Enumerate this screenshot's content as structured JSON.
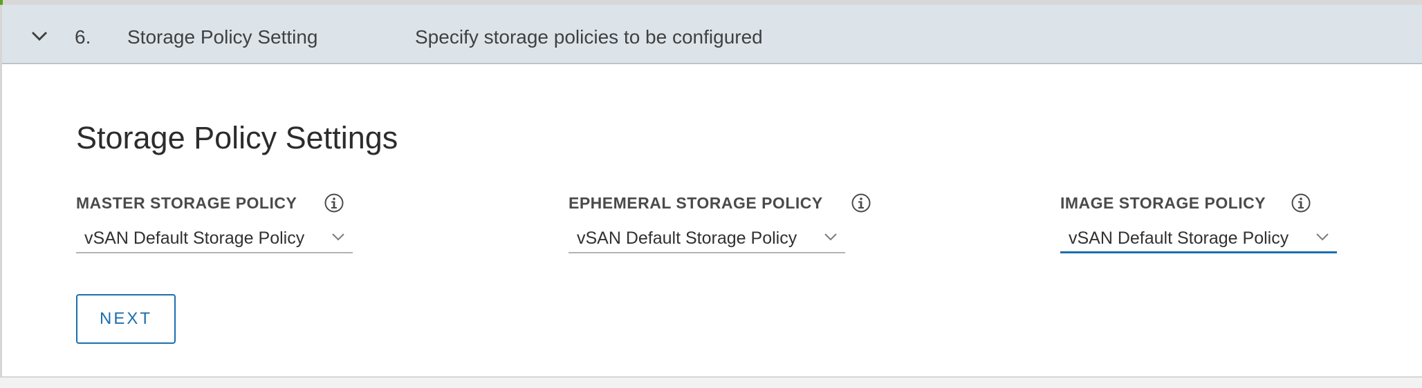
{
  "step": {
    "number": "6.",
    "title": "Storage Policy Setting",
    "description": "Specify storage policies to be configured",
    "expanded": true
  },
  "section": {
    "title": "Storage Policy Settings"
  },
  "fields": {
    "master": {
      "label": "MASTER STORAGE POLICY",
      "value": "vSAN Default Storage Policy"
    },
    "ephemeral": {
      "label": "EPHEMERAL STORAGE POLICY",
      "value": "vSAN Default Storage Policy"
    },
    "image": {
      "label": "IMAGE STORAGE POLICY",
      "value": "vSAN Default Storage Policy",
      "focused": true
    }
  },
  "actions": {
    "next_label": "NEXT"
  },
  "icons": {
    "step_toggle": "chevron-down-icon",
    "info": "info-icon",
    "select_caret": "caret-down-icon"
  },
  "colors": {
    "header_bg": "#dce4ea",
    "accent_blue": "#1b6eae",
    "status_green": "#5aa220"
  }
}
